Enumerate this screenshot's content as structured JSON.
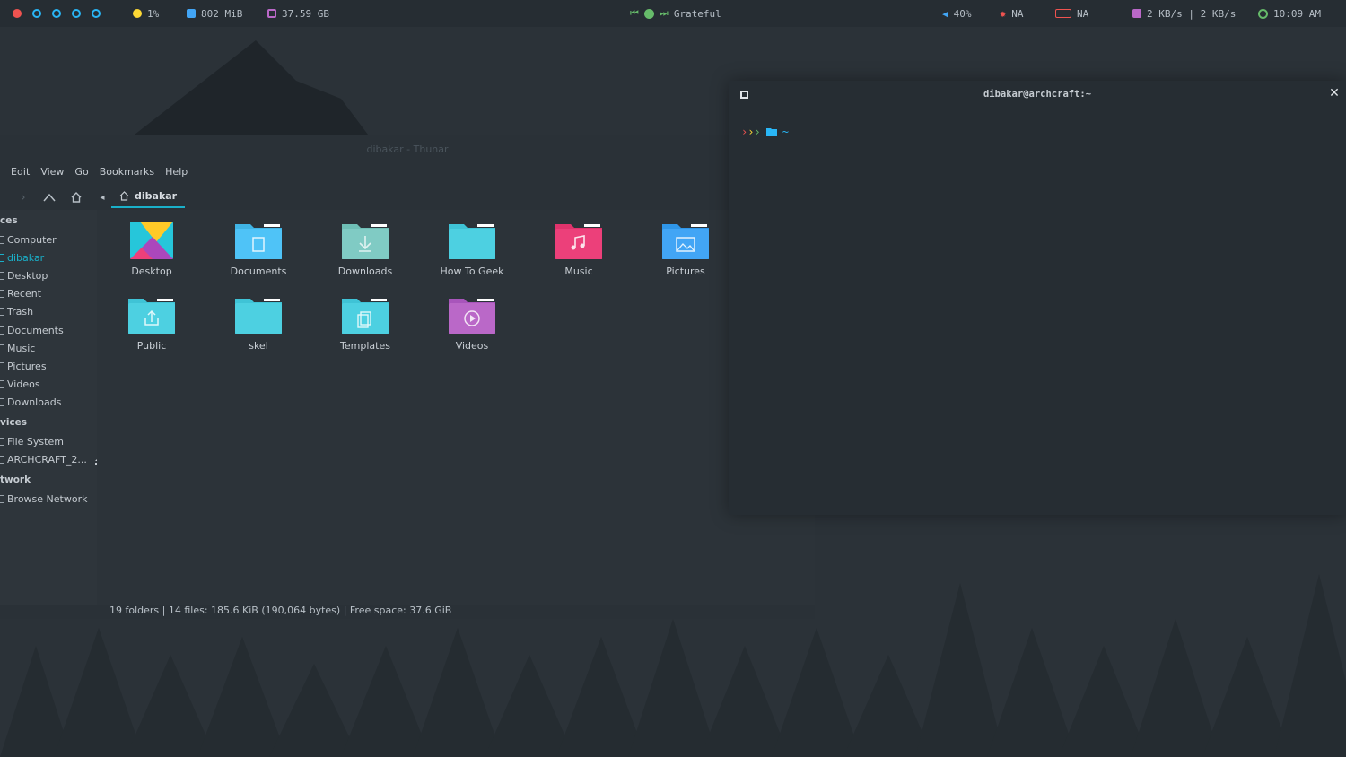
{
  "topbar": {
    "cpu": "1%",
    "memory": "802 MiB",
    "disk": "37.59 GB",
    "music_title": "Grateful",
    "volume": "40%",
    "brightness": "NA",
    "battery": "NA",
    "network": "2 KB/s | 2 KB/s",
    "clock": "10:09 AM"
  },
  "thunar": {
    "title": "dibakar - Thunar",
    "menu": [
      "Edit",
      "View",
      "Go",
      "Bookmarks",
      "Help"
    ],
    "breadcrumb": "dibakar",
    "sidebar": {
      "places_header": "ces",
      "places": [
        "Computer",
        "dibakar",
        "Desktop",
        "Recent",
        "Trash",
        "Documents",
        "Music",
        "Pictures",
        "Videos",
        "Downloads"
      ],
      "devices_header": "vices",
      "devices": [
        "File System",
        "ARCHCRAFT_2..."
      ],
      "network_header": "twork",
      "network": [
        "Browse Network"
      ]
    },
    "folders": [
      "Desktop",
      "Documents",
      "Downloads",
      "How To Geek",
      "Music",
      "Pictures",
      "Public",
      "skel",
      "Templates",
      "Videos"
    ],
    "status": "19 folders  |  14 files: 185.6 KiB (190,064 bytes)  |  Free space: 37.6 GiB"
  },
  "terminal": {
    "title": "dibakar@archcraft:~",
    "prompt_dir": "~"
  },
  "colors": {
    "accent": "#1ab0c9",
    "folder_cyan": "#4fd1e0",
    "folder_pink": "#ec407a",
    "folder_blue": "#42a5f5",
    "folder_purple": "#ba68c8",
    "folder_mint": "#80cbc4"
  }
}
